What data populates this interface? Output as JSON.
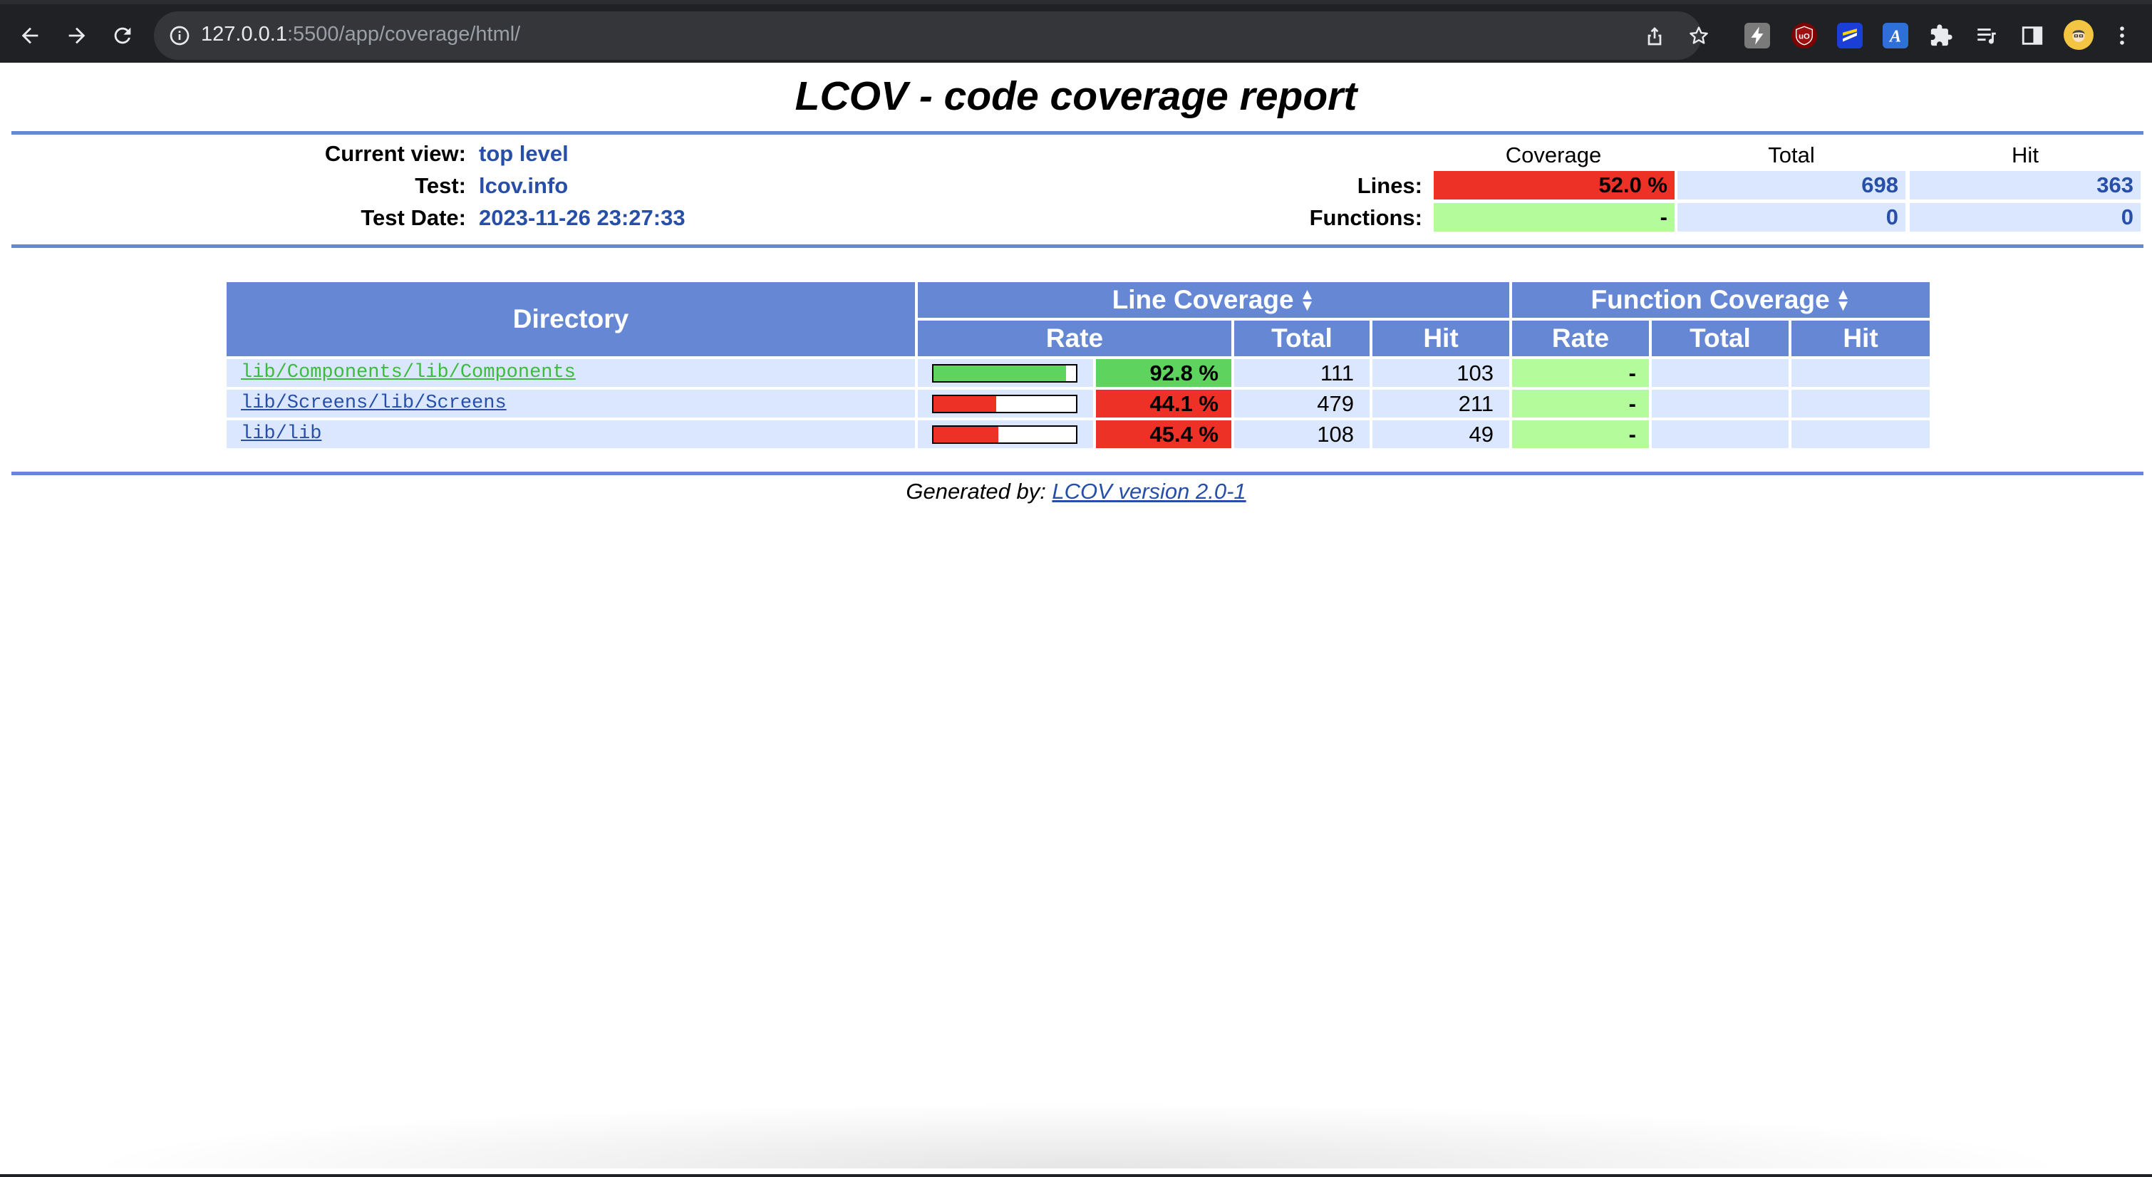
{
  "browser": {
    "url_host": "127.0.0.1",
    "url_rest": ":5500/app/coverage/html/"
  },
  "report": {
    "title": "LCOV - code coverage report",
    "info": {
      "current_view_label": "Current view:",
      "current_view_value": "top level",
      "test_label": "Test:",
      "test_value": "lcov.info",
      "test_date_label": "Test Date:",
      "test_date_value": "2023-11-26 23:27:33"
    },
    "summary": {
      "headers": [
        "Coverage",
        "Total",
        "Hit"
      ],
      "lines": {
        "label": "Lines:",
        "coverage": "52.0 %",
        "total": "698",
        "hit": "363"
      },
      "functions": {
        "label": "Functions:",
        "coverage": "-",
        "total": "0",
        "hit": "0"
      }
    },
    "table": {
      "directory_header": "Directory",
      "line_coverage_header": "Line Coverage",
      "function_coverage_header": "Function Coverage",
      "sub_headers": [
        "Rate",
        "Total",
        "Hit",
        "Rate",
        "Total",
        "Hit"
      ],
      "rows": [
        {
          "directory": "lib/Components/lib/Components",
          "rate": "92.8 %",
          "rate_fraction": 0.928,
          "total": "111",
          "hit": "103",
          "fn_rate": "-",
          "fn_total": "",
          "fn_hit": ""
        },
        {
          "directory": "lib/Screens/lib/Screens",
          "rate": "44.1 %",
          "rate_fraction": 0.441,
          "total": "479",
          "hit": "211",
          "fn_rate": "-",
          "fn_total": "",
          "fn_hit": ""
        },
        {
          "directory": "lib/lib",
          "rate": "45.4 %",
          "rate_fraction": 0.454,
          "total": "108",
          "hit": "49",
          "fn_rate": "-",
          "fn_total": "",
          "fn_hit": ""
        }
      ]
    },
    "footer": {
      "prefix": "Generated by: ",
      "link": "LCOV version 2.0-1"
    }
  },
  "colors": {
    "header_blue": "#6688d4",
    "row_blue": "#dae7fe",
    "value_blue": "#284fa8",
    "low_red": "#ee3127",
    "high_green": "#5ed35e",
    "fn_green": "#b4fb9b"
  }
}
